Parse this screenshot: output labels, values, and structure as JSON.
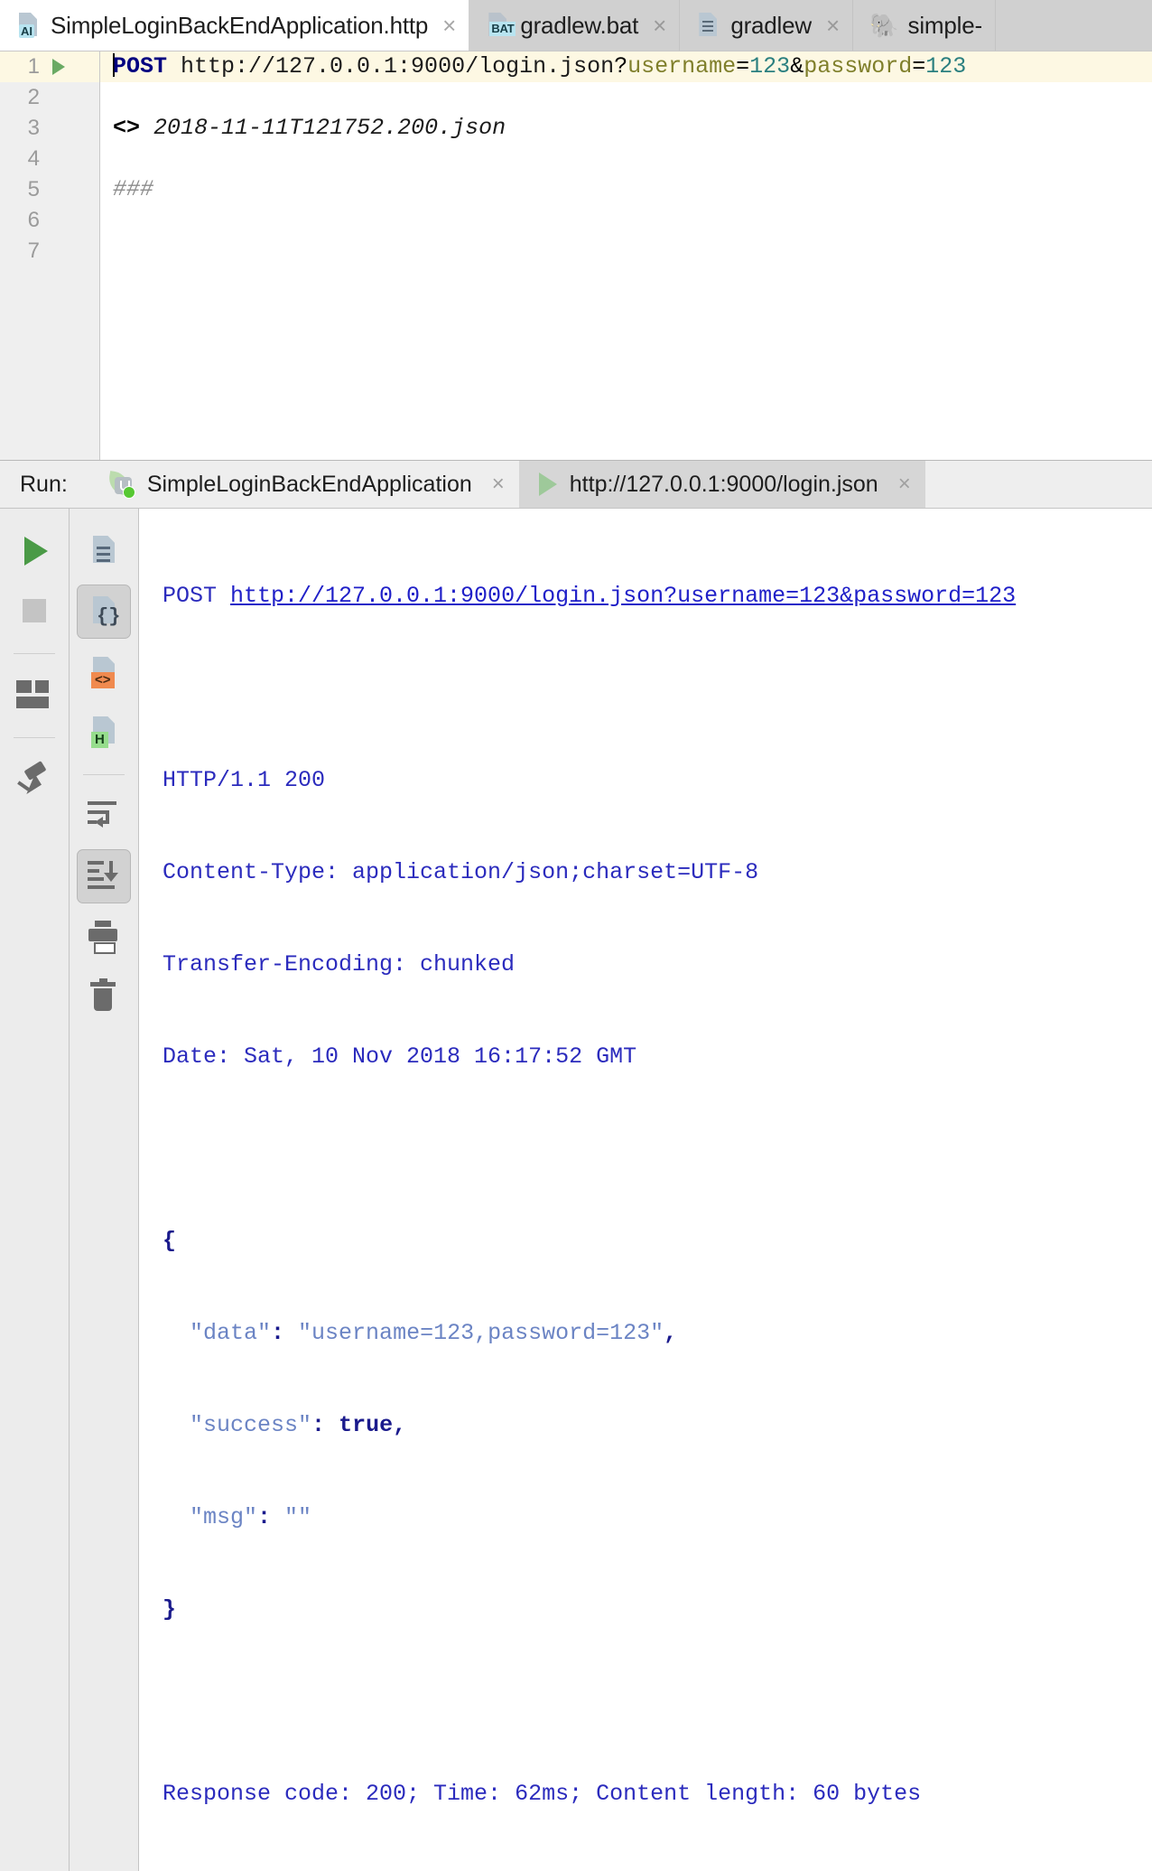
{
  "editor_tabs": [
    {
      "label": "SimpleLoginBackEndApplication.http",
      "icon": "http-file-icon",
      "badge": "AI",
      "active": true,
      "close": "×"
    },
    {
      "label": "gradlew.bat",
      "icon": "bat-file-icon",
      "badge": "BAT",
      "active": false,
      "close": "×"
    },
    {
      "label": "gradlew",
      "icon": "text-file-icon",
      "badge": "",
      "active": false,
      "close": "×"
    },
    {
      "label": "simple-",
      "icon": "gradle-elephant-icon",
      "badge": "",
      "active": false,
      "close": ""
    }
  ],
  "editor": {
    "line_numbers": [
      "1",
      "2",
      "3",
      "4",
      "5",
      "6",
      "7"
    ],
    "current_line": 1,
    "gutter_run_icon": "run-request-icon",
    "lines": [
      {
        "n": 1,
        "method": "POST",
        "url_base": " http://127.0.0.1:9000/login.json",
        "q_mark": "?",
        "p1_name": "username",
        "p1_eq": "=",
        "p1_value": "123",
        "amp": "&",
        "p2_name": "password",
        "p2_eq": "=",
        "p2_value": "123"
      },
      {
        "n": 2,
        "text": ""
      },
      {
        "n": 3,
        "marker": "<>",
        "filename": "2018-11-11T121752.200.json"
      },
      {
        "n": 4,
        "text": ""
      },
      {
        "n": 5,
        "comment": "###"
      },
      {
        "n": 6,
        "text": ""
      },
      {
        "n": 7,
        "text": ""
      }
    ]
  },
  "run_panel": {
    "title": "Run:",
    "tabs": [
      {
        "label": "SimpleLoginBackEndApplication",
        "icon": "spring-boot-icon",
        "selected": false,
        "close": "×"
      },
      {
        "label": "http://127.0.0.1:9000/login.json",
        "icon": "run-green-play-icon",
        "selected": true,
        "close": "×"
      }
    ],
    "left_toolbar": [
      {
        "name": "rerun-button",
        "icon": "play-green-icon"
      },
      {
        "name": "stop-button",
        "icon": "stop-square-icon"
      },
      {
        "name": "layout-button",
        "icon": "layout-icon"
      },
      {
        "name": "pin-tab-button",
        "icon": "pin-icon"
      }
    ],
    "right_toolbar": [
      {
        "name": "open-in-text-button",
        "icon": "text-file-icon",
        "selected": false
      },
      {
        "name": "open-in-json-button",
        "icon": "json-file-icon",
        "selected": true
      },
      {
        "name": "open-in-html-button",
        "icon": "code-file-icon",
        "badge": "<>"
      },
      {
        "name": "open-in-h-button",
        "icon": "h-file-icon",
        "badge": "H"
      },
      {
        "name": "soft-wrap-button",
        "icon": "soft-wrap-icon",
        "selected": false
      },
      {
        "name": "scroll-to-end-button",
        "icon": "scroll-to-end-icon",
        "selected": true
      },
      {
        "name": "print-button",
        "icon": "printer-icon"
      },
      {
        "name": "clear-all-button",
        "icon": "trash-icon"
      }
    ],
    "console": {
      "request_method": "POST ",
      "request_url": "http://127.0.0.1:9000/login.json?username=123&password=123",
      "status_line": "HTTP/1.1 200",
      "headers": [
        "Content-Type: application/json;charset=UTF-8",
        "Transfer-Encoding: chunked",
        "Date: Sat, 10 Nov 2018 16:17:52 GMT"
      ],
      "body_open": "{",
      "body_entries": [
        {
          "key": "\"data\"",
          "sep": ": ",
          "value": "\"username=123,password=123\"",
          "type": "string",
          "tail": ","
        },
        {
          "key": "\"success\"",
          "sep": ": ",
          "value": "true",
          "type": "bool",
          "tail": ","
        },
        {
          "key": "\"msg\"",
          "sep": ": ",
          "value": "\"\"",
          "type": "string",
          "tail": ""
        }
      ],
      "body_close": "}",
      "summary": "Response code: 200; Time: 62ms; Content length: 60 bytes"
    }
  },
  "colors": {
    "method_keyword": "#000080",
    "query_param": "#7f7f2b",
    "query_value": "#2a7f7f",
    "console_text": "#2b2bbd",
    "json_key": "#6b84c4",
    "current_line_bg": "#fdf8e3",
    "run_green": "#4a9a46"
  }
}
